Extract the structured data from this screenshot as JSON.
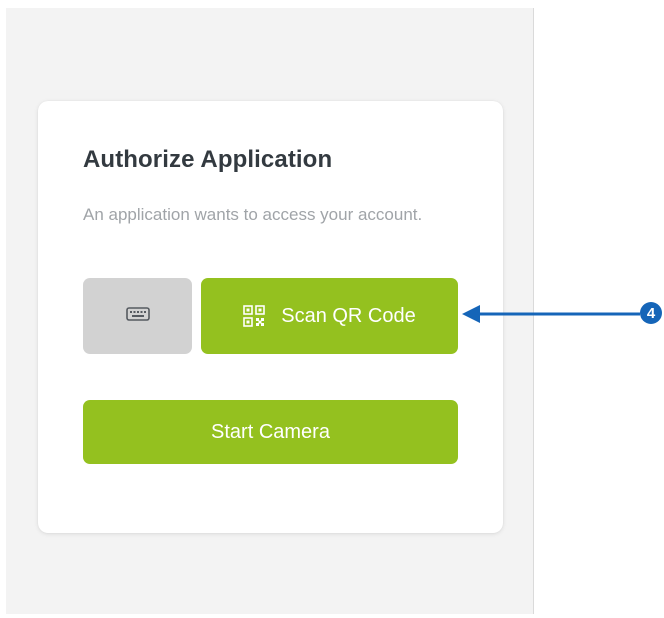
{
  "card": {
    "title": "Authorize Application",
    "description": "An application wants to access your account."
  },
  "buttons": {
    "keyboard_icon": "keyboard-icon",
    "scan_qr_label": "Scan QR Code",
    "scan_qr_icon": "qr-code-icon",
    "start_camera_label": "Start Camera"
  },
  "callout": {
    "number": "4"
  },
  "colors": {
    "accent": "#94c11f",
    "secondary_button": "#d2d2d2",
    "callout": "#1565b8"
  }
}
